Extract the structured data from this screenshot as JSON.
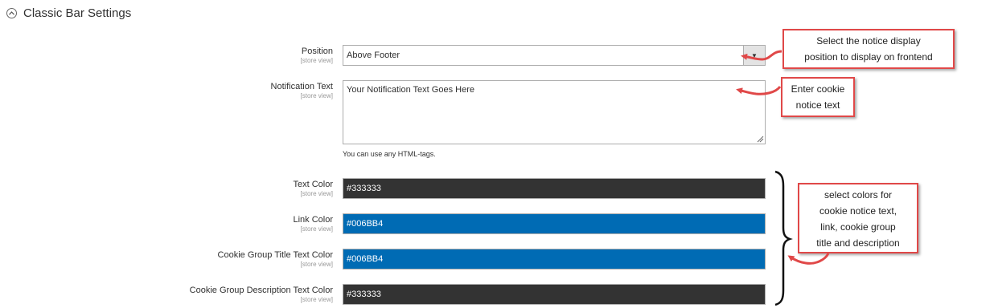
{
  "section": {
    "title": "Classic Bar Settings"
  },
  "fields": {
    "position": {
      "label": "Position",
      "scope": "[store view]",
      "value": "Above Footer"
    },
    "notification_text": {
      "label": "Notification Text",
      "scope": "[store view]",
      "value": "Your Notification Text Goes Here",
      "note": "You can use any HTML-tags."
    },
    "text_color": {
      "label": "Text Color",
      "scope": "[store view]",
      "value": "#333333",
      "swatch": "#333333"
    },
    "link_color": {
      "label": "Link Color",
      "scope": "[store view]",
      "value": "#006BB4",
      "swatch": "#006BB4"
    },
    "cookie_group_title_text_color": {
      "label": "Cookie Group Title Text Color",
      "scope": "[store view]",
      "value": "#006BB4",
      "swatch": "#006BB4"
    },
    "cookie_group_description_text_color": {
      "label": "Cookie Group Description Text Color",
      "scope": "[store view]",
      "value": "#333333",
      "swatch": "#333333"
    }
  },
  "callouts": {
    "position": {
      "line1": "Select the notice display",
      "line2": "position to display on frontend"
    },
    "notification": {
      "line1": "Enter cookie",
      "line2": "notice text"
    },
    "colors": {
      "line1": "select colors for",
      "line2": "cookie notice text,",
      "line3": "link, cookie group",
      "line4": "title and description"
    }
  },
  "annotation_color": "#e04848",
  "icons": {
    "collapse": "chevron-up-circle-icon",
    "select_arrow": "caret-down-icon"
  }
}
